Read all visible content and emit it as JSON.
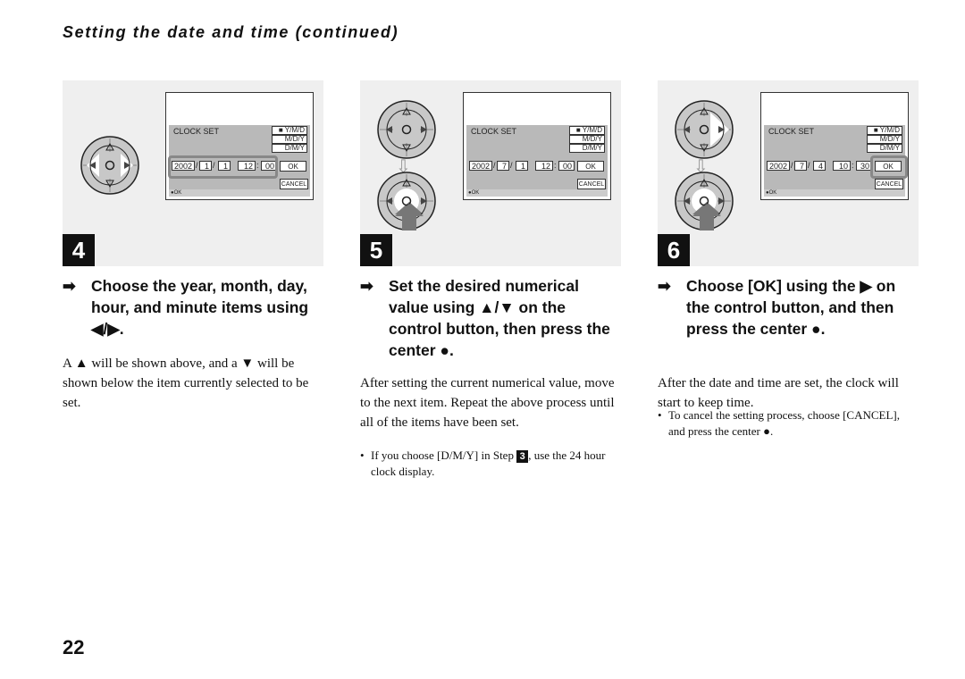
{
  "title": "Setting the date and time (continued)",
  "page_number": "22",
  "screen": {
    "clock_set": "CLOCK SET",
    "formats": [
      "■ Y/M/D",
      "M/D/Y",
      "D/M/Y"
    ],
    "ok": "OK",
    "cancel": "CANCEL",
    "ok_bar": "●OK"
  },
  "steps": [
    {
      "number": "4",
      "date": [
        "2002",
        "1",
        "1",
        "12",
        "00"
      ],
      "highlight": "fields",
      "heading": "Choose the year, month, day, hour, and minute items using ◀/▶.",
      "body": "A ▲ will be shown above, and a ▼ will be shown below the item currently selected to be set."
    },
    {
      "number": "5",
      "date": [
        "2002",
        "7",
        "1",
        "12",
        "00"
      ],
      "highlight": "none",
      "heading": "Set the desired numerical value using ▲/▼ on the control button, then press the center ●.",
      "body": "After setting the current numerical value, move to the next item. Repeat the above process until all of the items have been set.",
      "note": "If you choose [D/M/Y] in Step",
      "note_step": "3",
      "note_end": ", use the 24 hour clock display."
    },
    {
      "number": "6",
      "date": [
        "2002",
        "7",
        "4",
        "10",
        "30"
      ],
      "highlight": "ok",
      "heading": "Choose [OK] using the ▶ on the control button, and then press the center ●.",
      "body": "After the date and time are set, the clock will start to keep time.",
      "note": "To cancel the setting process, choose [CANCEL], and press the center ●."
    }
  ],
  "arrow_glyph": "➡",
  "bullet": "•",
  "colors": {
    "panel": "#efefef",
    "screen_gray": "#b9b9b9",
    "badge": "#111111"
  }
}
